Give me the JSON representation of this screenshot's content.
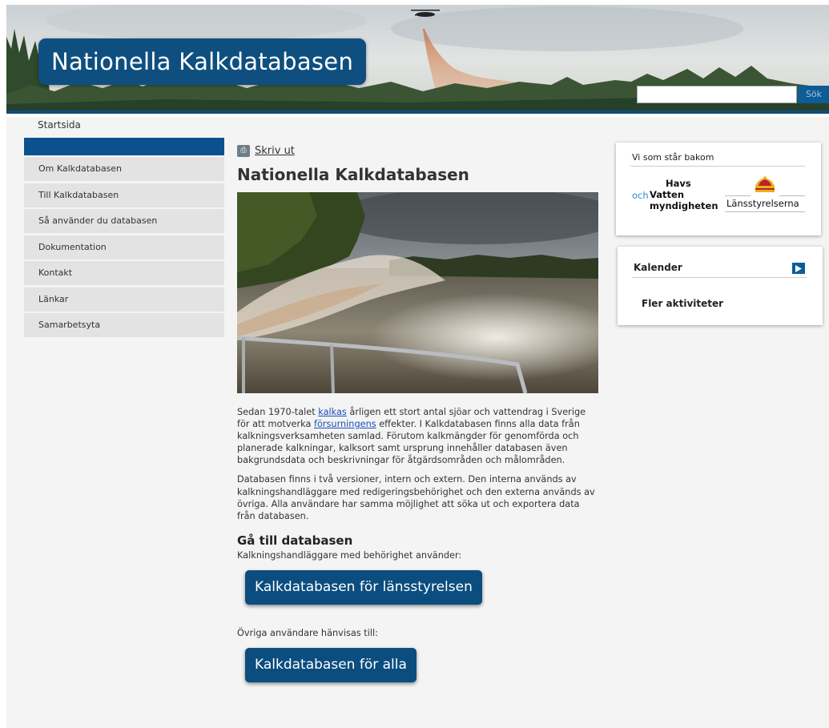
{
  "header": {
    "site_title": "Nationella Kalkdatabasen",
    "search": {
      "value": "",
      "button_label": "Sök"
    }
  },
  "breadcrumb": {
    "home": "Startsida"
  },
  "sidebar": {
    "items": [
      {
        "label": "Om Kalkdatabasen"
      },
      {
        "label": "Till Kalkdatabasen"
      },
      {
        "label": "Så använder du databasen"
      },
      {
        "label": "Dokumentation"
      },
      {
        "label": "Kontakt"
      },
      {
        "label": "Länkar"
      },
      {
        "label": "Samarbetsyta"
      }
    ]
  },
  "main": {
    "print_label": "Skriv ut",
    "title": "Nationella Kalkdatabasen",
    "para1": {
      "t1": "Sedan 1970-talet ",
      "link1": "kalkas",
      "t2": " årligen ett stort antal sjöar och vattendrag i Sverige för att motverka ",
      "link2": "försurningens",
      "t3": " effekter. I Kalkdatabasen finns alla data från kalkningsverksamheten samlad. Förutom kalkmängder för genomförda och planerade kalkningar, kalksort samt ursprung innehåller databasen även bakgrundsdata och beskrivningar för åtgärdsområden och målområden."
    },
    "para2": "Databasen finns i två versioner, intern och extern. Den interna används av kalkningshandläggare med redigeringsbehörighet och den externa används av övriga. Alla användare har samma möjlighet att söka ut och exportera data från databasen.",
    "goto_title": "Gå till databasen",
    "goto_sub1": "Kalkningshandläggare med behörighet använder:",
    "button1": "Kalkdatabasen för länsstyrelsen",
    "goto_sub2": "Övriga användare hänvisas till:",
    "button2": "Kalkdatabasen för alla"
  },
  "right": {
    "backers": {
      "title": "Vi som står bakom",
      "hav": {
        "och": "och",
        "line1": "Havs",
        "line2": "Vatten",
        "line3": "myndigheten"
      },
      "lansstyrelsen": "Länsstyrelserna"
    },
    "calendar": {
      "title": "Kalender",
      "more": "Fler aktiviteter"
    }
  },
  "colors": {
    "brand_blue": "#0b4d7e",
    "page_bg": "#f4f4f4",
    "link": "#1a4fb8"
  }
}
